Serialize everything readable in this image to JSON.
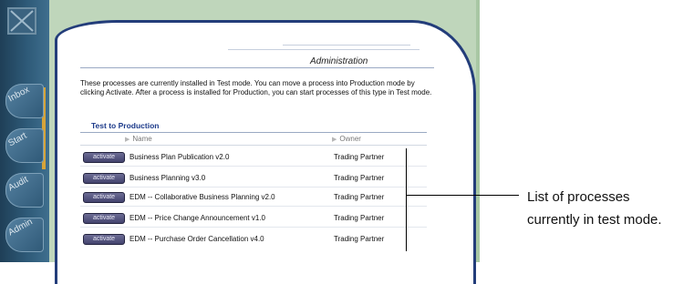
{
  "nav": {
    "tabs": [
      "Inbox",
      "Start",
      "Audit",
      "Admin"
    ]
  },
  "page": {
    "heading": "Administration",
    "intro": "These processes are currently installed in Test mode. You can move a process into Production mode by clicking Activate. After a process is installed for Production, you can start processes of this type in Test mode.",
    "section_title": "Test to Production"
  },
  "table": {
    "columns": [
      "Name",
      "Owner"
    ],
    "button_label": "activate",
    "rows": [
      {
        "name": "Business Plan Publication v2.0",
        "owner": "Trading Partner"
      },
      {
        "name": "Business Planning v3.0",
        "owner": "Trading Partner"
      },
      {
        "name": "EDM -- Collaborative Business Planning v2.0",
        "owner": "Trading Partner"
      },
      {
        "name": "EDM -- Price Change Announcement v1.0",
        "owner": "Trading Partner"
      },
      {
        "name": "EDM -- Purchase Order Cancellation v4.0",
        "owner": "Trading Partner"
      }
    ]
  },
  "callout": {
    "line1": "List of processes",
    "line2": "currently in test mode."
  },
  "colors": {
    "rail": "#2e5a78",
    "frame_green": "#a8c7a4",
    "panel_border": "#233d7a",
    "section_title": "#1c3a8a",
    "activate_button": "#55557f"
  },
  "icons": {
    "logo": "x-box-icon",
    "column_sort": "triangle-right-icon"
  }
}
